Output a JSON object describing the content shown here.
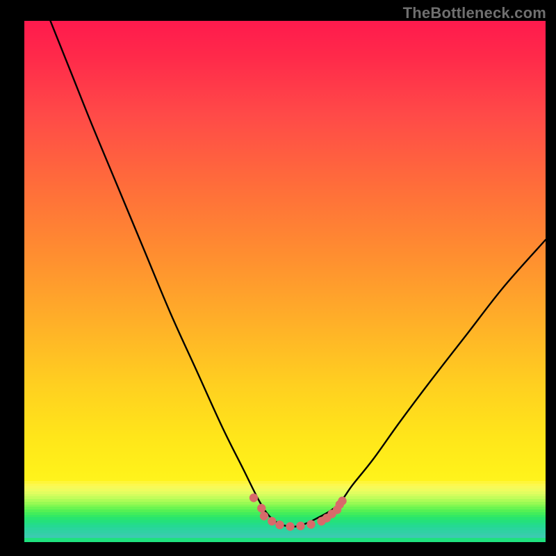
{
  "watermark": "TheBottleneck.com",
  "chart_data": {
    "type": "line",
    "title": "",
    "xlabel": "",
    "ylabel": "",
    "xlim": [
      0,
      100
    ],
    "ylim": [
      0,
      100
    ],
    "series": [
      {
        "name": "bottleneck-curve",
        "x": [
          5,
          9,
          13,
          18,
          23,
          28,
          33,
          38,
          42,
          45,
          47,
          49,
          51,
          53,
          56,
          60,
          63,
          67,
          72,
          78,
          85,
          92,
          100
        ],
        "y": [
          100,
          90,
          80,
          68,
          56,
          44,
          33,
          22,
          14,
          8,
          5,
          3.5,
          3,
          3.2,
          4.5,
          7,
          11,
          16,
          23,
          31,
          40,
          49,
          58
        ]
      }
    ],
    "markers": {
      "name": "highlight-dots",
      "color": "#d86a6a",
      "points": [
        {
          "x": 44,
          "y": 8.5
        },
        {
          "x": 45.5,
          "y": 6.5
        },
        {
          "x": 46,
          "y": 5.0
        },
        {
          "x": 47.5,
          "y": 4.0
        },
        {
          "x": 49,
          "y": 3.3
        },
        {
          "x": 51,
          "y": 3.0
        },
        {
          "x": 53,
          "y": 3.1
        },
        {
          "x": 55,
          "y": 3.4
        },
        {
          "x": 57,
          "y": 4.0
        },
        {
          "x": 58,
          "y": 4.6
        },
        {
          "x": 59,
          "y": 5.4
        },
        {
          "x": 60,
          "y": 6.2
        },
        {
          "x": 60.5,
          "y": 7.2
        },
        {
          "x": 61,
          "y": 7.9
        }
      ]
    },
    "background": {
      "gradient_top_color": "#ff1a4d",
      "gradient_bottom_color": "#fff31c",
      "bottom_band_stripes": [
        "#fff63a",
        "#fdf84d",
        "#f7fa58",
        "#eefc5e",
        "#e2fd60",
        "#d3fd5e",
        "#c2fd5b",
        "#aefc57",
        "#99fa53",
        "#83f851",
        "#6cf551",
        "#55f154",
        "#42ed5b",
        "#33e964",
        "#29e56f",
        "#24e17b",
        "#23dd87",
        "#25d992",
        "#2ad59c",
        "#30d1a4",
        "#36ceaa",
        "#3ccab0"
      ],
      "final_green": "#1fe27e"
    }
  }
}
